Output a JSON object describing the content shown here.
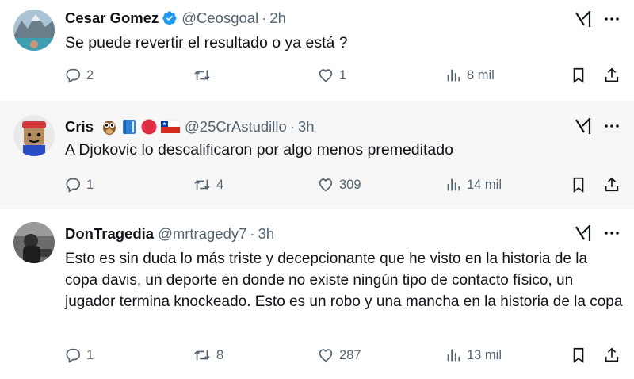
{
  "colors": {
    "text": "#0f1419",
    "secondary": "#536471",
    "verified": "#1d9bf0",
    "highlight_bg": "#f7f7f7"
  },
  "tweets": [
    {
      "name": "Cesar Gomez",
      "verified": true,
      "handle": "@Ceosgoal",
      "dot": "·",
      "time": "2h",
      "text": "Se puede revertir el resultado o ya está ?",
      "replies": "2",
      "retweets": "",
      "likes": "1",
      "views": "8 mil"
    },
    {
      "name": "Cris",
      "emojis": [
        "owl-emoji",
        "blue-book-emoji",
        "red-circle-emoji",
        "chile-flag-emoji"
      ],
      "handle": "@25CrAstudillo",
      "dot": "·",
      "time": "3h",
      "text": "A Djokovic lo descalificaron por algo menos premeditado",
      "replies": "1",
      "retweets": "4",
      "likes": "309",
      "views": "14 mil"
    },
    {
      "name": "DonTragedia",
      "handle": "@mrtragedy7",
      "dot": "·",
      "time": "3h",
      "text": "Esto es sin duda lo más triste y decepcionante que he visto en la historia de la copa davis, un deporte en donde no existe ningún tipo de contacto físico, un jugador termina knockeado. Esto es un robo y una mancha en la historia de la copa",
      "replies": "1",
      "retweets": "8",
      "likes": "287",
      "views": "13 mil"
    }
  ]
}
